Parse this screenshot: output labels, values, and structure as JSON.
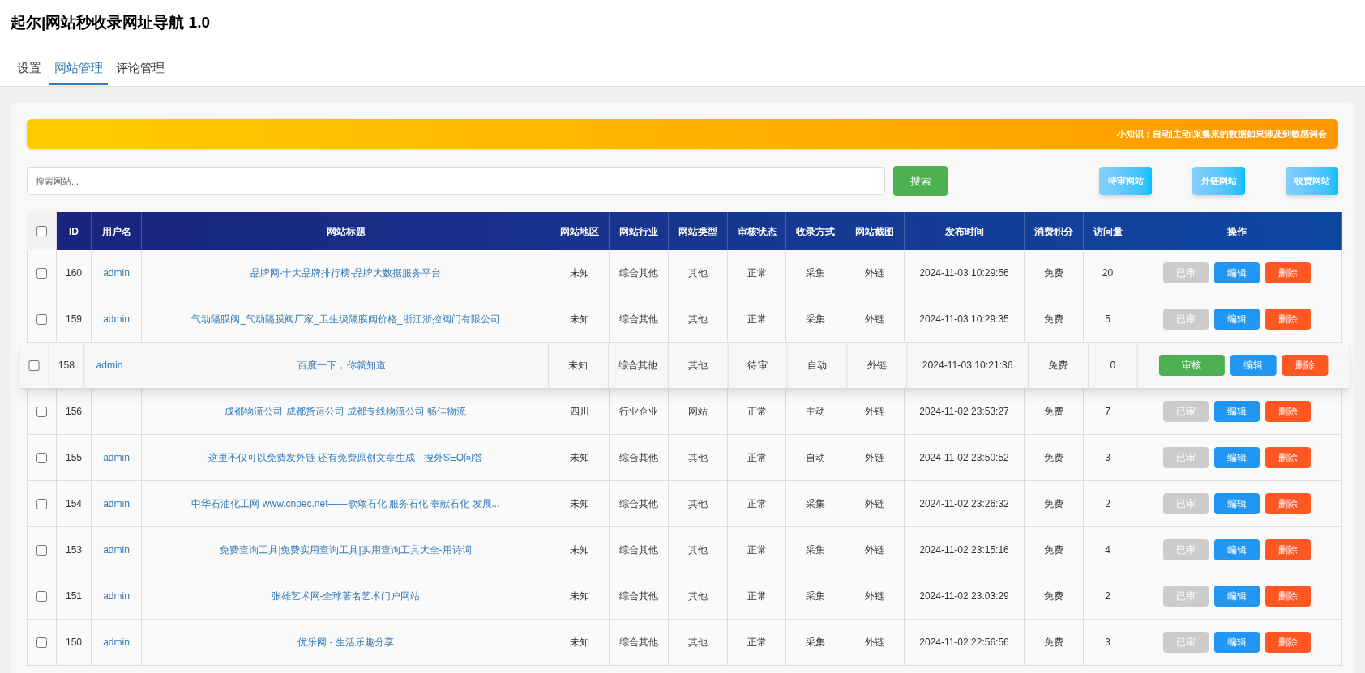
{
  "window": {
    "title": "起尔|网站秒收录网址导航 1.0"
  },
  "tabs": [
    {
      "label": "设置",
      "selected": false
    },
    {
      "label": "网站管理",
      "selected": true
    },
    {
      "label": "评论管理",
      "selected": false
    }
  ],
  "notice": "小知识：自动|主动|采集来的数据如果涉及到敏感词会",
  "search": {
    "placeholder": "搜索网站...",
    "button": "搜索"
  },
  "filter_buttons": [
    "待审网站",
    "外链网站",
    "收费网站"
  ],
  "table": {
    "select_all": {
      "checked": false
    },
    "columns": [
      "ID",
      "用户名",
      "网站标题",
      "网站地区",
      "网站行业",
      "网站类型",
      "审核状态",
      "收录方式",
      "网站截图",
      "发布时间",
      "消费积分",
      "访问量",
      "操作"
    ],
    "rows": [
      {
        "checked": false,
        "highlighted": false,
        "cells": [
          "160",
          "admin",
          "品牌网-十大品牌排行榜-品牌大数据服务平台",
          "未知",
          "综合其他",
          "其他",
          "正常",
          "采集",
          "外链",
          "2024-11-03 10:29:56",
          "免费",
          "20"
        ],
        "actions": [
          {
            "label": "已审",
            "kind": "approved"
          },
          {
            "label": "编辑",
            "kind": "edit"
          },
          {
            "label": "删除",
            "kind": "delete"
          }
        ]
      },
      {
        "checked": false,
        "highlighted": false,
        "cells": [
          "159",
          "admin",
          "气动隔膜阀_气动隔膜阀厂家_卫生级隔膜阀价格_浙江浙控阀门有限公司",
          "未知",
          "综合其他",
          "其他",
          "正常",
          "采集",
          "外链",
          "2024-11-03 10:29:35",
          "免费",
          "5"
        ],
        "actions": [
          {
            "label": "已审",
            "kind": "approved"
          },
          {
            "label": "编辑",
            "kind": "edit"
          },
          {
            "label": "删除",
            "kind": "delete"
          }
        ]
      },
      {
        "checked": false,
        "highlighted": true,
        "cells": [
          "158",
          "admin",
          "百度一下，你就知道",
          "未知",
          "综合其他",
          "其他",
          "待审",
          "自动",
          "外链",
          "2024-11-03 10:21:36",
          "免费",
          "0"
        ],
        "actions": [
          {
            "label": "审核",
            "kind": "approve"
          },
          {
            "label": "编辑",
            "kind": "edit"
          },
          {
            "label": "删除",
            "kind": "delete"
          }
        ]
      },
      {
        "checked": false,
        "highlighted": false,
        "cells": [
          "156",
          "",
          "成都物流公司 成都货运公司 成都专线物流公司 畅佳物流",
          "四川",
          "行业企业",
          "网站",
          "正常",
          "主动",
          "外链",
          "2024-11-02 23:53:27",
          "免费",
          "7"
        ],
        "actions": [
          {
            "label": "已审",
            "kind": "approved"
          },
          {
            "label": "编辑",
            "kind": "edit"
          },
          {
            "label": "删除",
            "kind": "delete"
          }
        ]
      },
      {
        "checked": false,
        "highlighted": false,
        "cells": [
          "155",
          "admin",
          "这里不仅可以免费发外链 还有免费原创文章生成 - 搜外SEO问答",
          "未知",
          "综合其他",
          "其他",
          "正常",
          "自动",
          "外链",
          "2024-11-02 23:50:52",
          "免费",
          "3"
        ],
        "actions": [
          {
            "label": "已审",
            "kind": "approved"
          },
          {
            "label": "编辑",
            "kind": "edit"
          },
          {
            "label": "删除",
            "kind": "delete"
          }
        ]
      },
      {
        "checked": false,
        "highlighted": false,
        "cells": [
          "154",
          "admin",
          "中华石油化工网 www.cnpec.net——歌颂石化 服务石化 奉献石化 发展...",
          "未知",
          "综合其他",
          "其他",
          "正常",
          "采集",
          "外链",
          "2024-11-02 23:26:32",
          "免费",
          "2"
        ],
        "actions": [
          {
            "label": "已审",
            "kind": "approved"
          },
          {
            "label": "编辑",
            "kind": "edit"
          },
          {
            "label": "删除",
            "kind": "delete"
          }
        ]
      },
      {
        "checked": false,
        "highlighted": false,
        "cells": [
          "153",
          "admin",
          "免费查询工具|免费实用查询工具|实用查询工具大全-用诗词",
          "未知",
          "综合其他",
          "其他",
          "正常",
          "采集",
          "外链",
          "2024-11-02 23:15:16",
          "免费",
          "4"
        ],
        "actions": [
          {
            "label": "已审",
            "kind": "approved"
          },
          {
            "label": "编辑",
            "kind": "edit"
          },
          {
            "label": "删除",
            "kind": "delete"
          }
        ]
      },
      {
        "checked": false,
        "highlighted": false,
        "cells": [
          "151",
          "admin",
          "张雄艺术网-全球著名艺术门户网站",
          "未知",
          "综合其他",
          "其他",
          "正常",
          "采集",
          "外链",
          "2024-11-02 23:03:29",
          "免费",
          "2"
        ],
        "actions": [
          {
            "label": "已审",
            "kind": "approved"
          },
          {
            "label": "编辑",
            "kind": "edit"
          },
          {
            "label": "删除",
            "kind": "delete"
          }
        ]
      },
      {
        "checked": false,
        "highlighted": false,
        "cells": [
          "150",
          "admin",
          "优乐网 - 生活乐趣分享",
          "未知",
          "综合其他",
          "其他",
          "正常",
          "采集",
          "外链",
          "2024-11-02 22:56:56",
          "免费",
          "3"
        ],
        "actions": [
          {
            "label": "已审",
            "kind": "approved"
          },
          {
            "label": "编辑",
            "kind": "edit"
          },
          {
            "label": "删除",
            "kind": "delete"
          }
        ]
      }
    ]
  }
}
